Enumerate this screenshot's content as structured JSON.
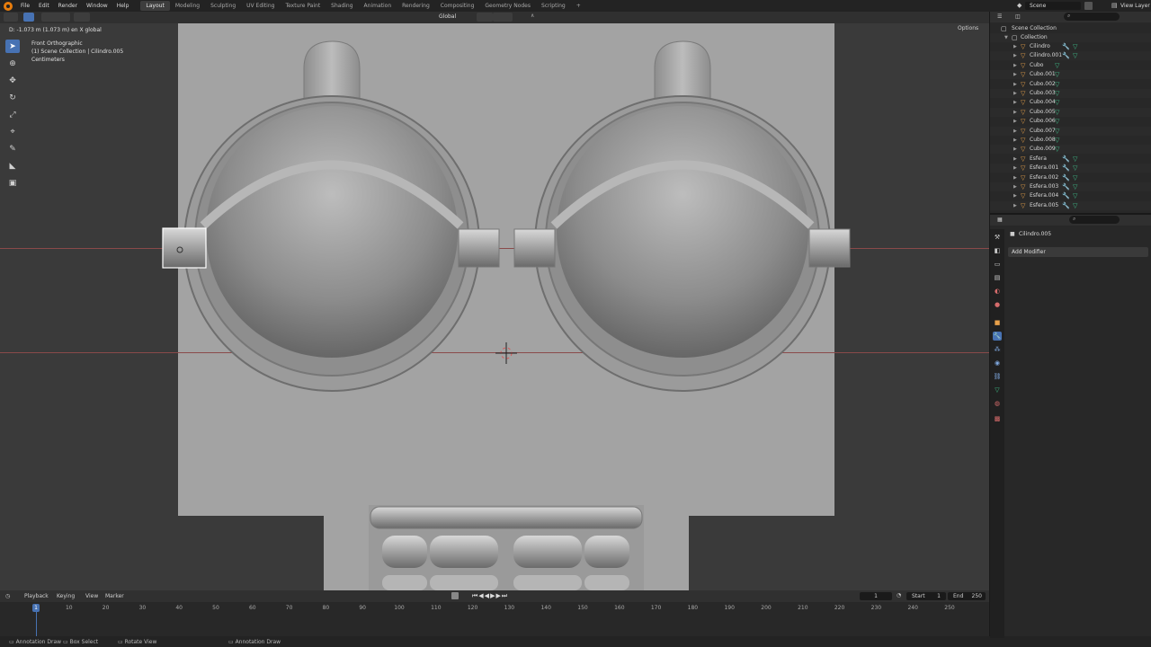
{
  "topbar": {
    "menus": [
      "File",
      "Edit",
      "Render",
      "Window",
      "Help"
    ],
    "workspaces": [
      "Layout",
      "Modeling",
      "Sculpting",
      "UV Editing",
      "Texture Paint",
      "Shading",
      "Animation",
      "Rendering",
      "Compositing",
      "Geometry Nodes",
      "Scripting"
    ],
    "active_workspace": "Layout",
    "scene": "Scene",
    "view_layer": "View Layer"
  },
  "viewport_header": {
    "transform_orientation": "Global",
    "options": "Options"
  },
  "viewport": {
    "distance_readout": "D: -1.073 m (1.073 m) en X global",
    "view_name": "Front Orthographic",
    "collection_info": "(1) Scene Collection | Cilindro.005",
    "units": "Centimeters"
  },
  "outliner": {
    "root": "Scene Collection",
    "collection": "Collection",
    "items": [
      {
        "name": "Cilindro",
        "modifier": true,
        "selected": false
      },
      {
        "name": "Cilindro.001",
        "modifier": true,
        "selected": false
      },
      {
        "name": "Cubo",
        "modifier": false,
        "selected": false
      },
      {
        "name": "Cubo.001",
        "modifier": false,
        "selected": false
      },
      {
        "name": "Cubo.002",
        "modifier": false,
        "selected": false
      },
      {
        "name": "Cubo.003",
        "modifier": false,
        "selected": false
      },
      {
        "name": "Cubo.004",
        "modifier": false,
        "selected": false
      },
      {
        "name": "Cubo.005",
        "modifier": false,
        "selected": false
      },
      {
        "name": "Cubo.006",
        "modifier": false,
        "selected": false
      },
      {
        "name": "Cubo.007",
        "modifier": false,
        "selected": false
      },
      {
        "name": "Cubo.008",
        "modifier": false,
        "selected": false
      },
      {
        "name": "Cubo.009",
        "modifier": false,
        "selected": false
      },
      {
        "name": "Esfera",
        "modifier": true,
        "selected": false
      },
      {
        "name": "Esfera.001",
        "modifier": true,
        "selected": false
      },
      {
        "name": "Esfera.002",
        "modifier": true,
        "selected": false
      },
      {
        "name": "Esfera.003",
        "modifier": true,
        "selected": false
      },
      {
        "name": "Esfera.004",
        "modifier": true,
        "selected": false
      },
      {
        "name": "Esfera.005",
        "modifier": true,
        "selected": false
      }
    ]
  },
  "properties": {
    "object_name": "Cilindro.005",
    "add_modifier": "Add Modifier"
  },
  "timeline": {
    "menus": [
      "Playback",
      "Keying",
      "View",
      "Marker"
    ],
    "current_frame": "1",
    "start_label": "Start",
    "start": "1",
    "end_label": "End",
    "end": "250",
    "ticks": [
      "10",
      "20",
      "30",
      "40",
      "50",
      "60",
      "70",
      "80",
      "90",
      "100",
      "110",
      "120",
      "130",
      "140",
      "150",
      "160",
      "170",
      "180",
      "190",
      "200",
      "210",
      "220",
      "230",
      "240",
      "250"
    ],
    "playhead_label": "1"
  },
  "statusbar": {
    "left_action": "Annotation Draw",
    "box_select": "Box Select",
    "rotate_view": "Rotate View",
    "right_action": "Annotation Draw"
  },
  "colors": {
    "accent": "#4772b3",
    "selected_text": "#ffaf29",
    "object_icon": "#e8a14a",
    "mesh_icon": "#3fc08a"
  }
}
